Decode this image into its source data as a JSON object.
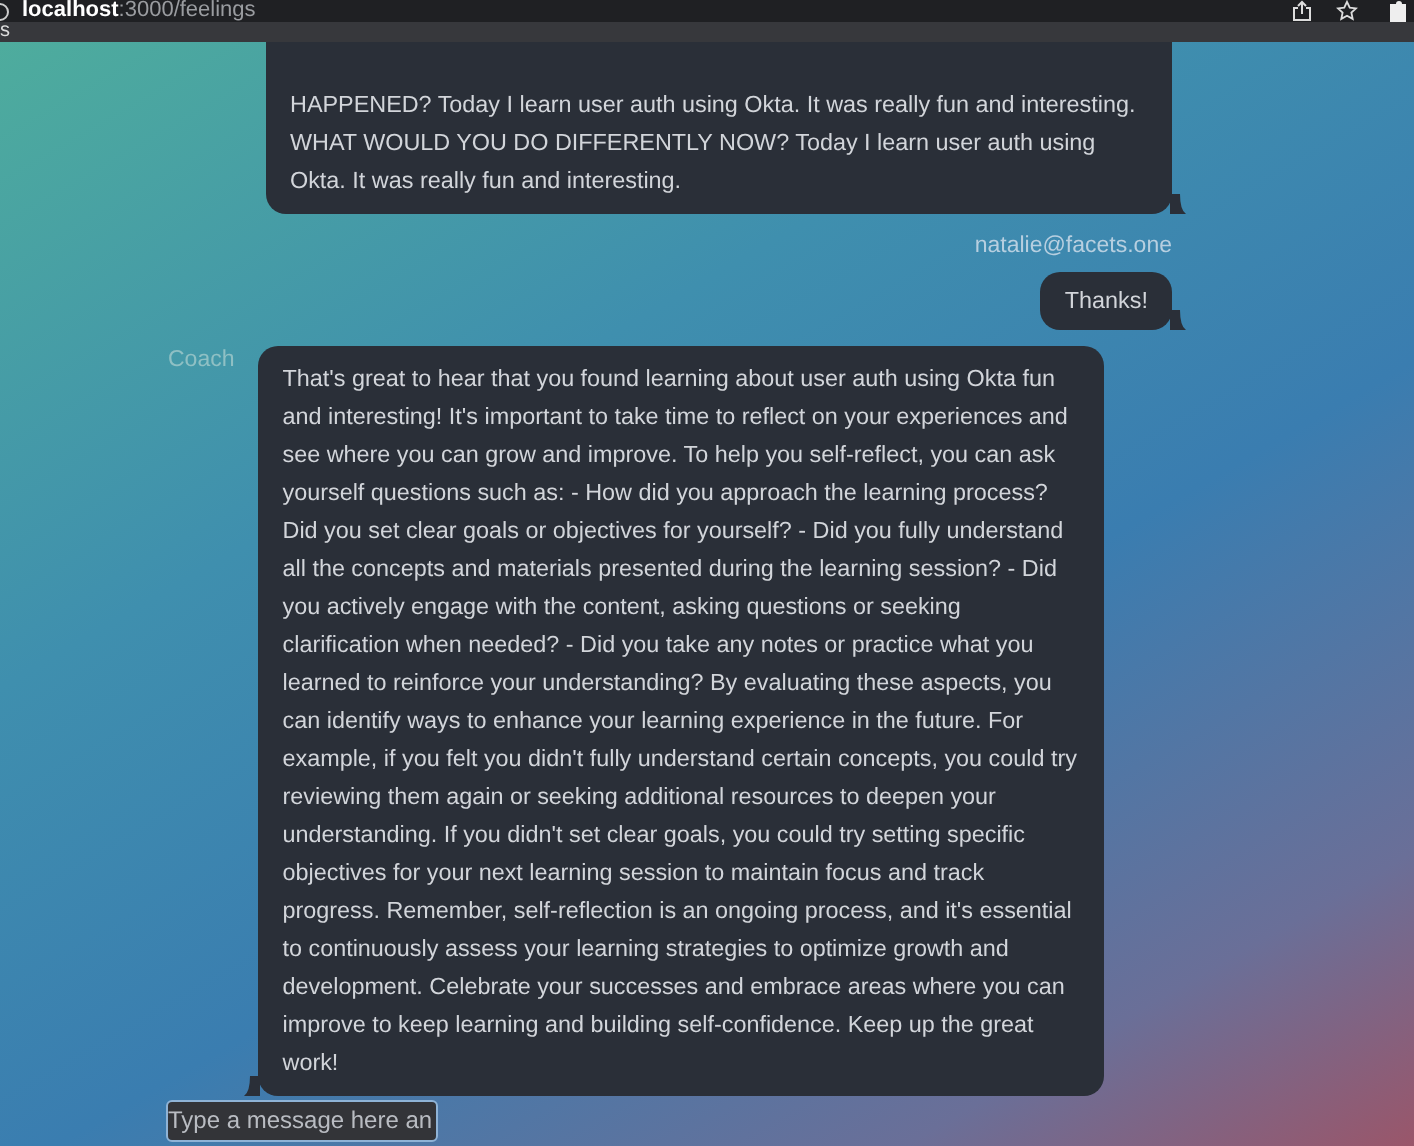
{
  "browser": {
    "url_host": "localhost",
    "url_path": ":3000/feelings",
    "bookmark": "s"
  },
  "messages": [
    {
      "kind": "user",
      "text": "HAPPENED? Today I learn user auth using Okta. It was really fun and interesting. WHAT WOULD YOU DO DIFFERENTLY NOW? Today I learn user auth using Okta. It was really fun and interesting."
    },
    {
      "kind": "user",
      "author": "natalie@facets.one",
      "text": "Thanks!"
    },
    {
      "kind": "coach",
      "author": "Coach",
      "text": "That's great to hear that you found learning about user auth using Okta fun and interesting! It's important to take time to reflect on your experiences and see where you can grow and improve. To help you self-reflect, you can ask yourself questions such as: - How did you approach the learning process? Did you set clear goals or objectives for yourself? - Did you fully understand all the concepts and materials presented during the learning session? - Did you actively engage with the content, asking questions or seeking clarification when needed? - Did you take any notes or practice what you learned to reinforce your understanding? By evaluating these aspects, you can identify ways to enhance your learning experience in the future. For example, if you felt you didn't fully understand certain concepts, you could try reviewing them again or seeking additional resources to deepen your understanding. If you didn't set clear goals, you could try setting specific objectives for your next learning session to maintain focus and track progress. Remember, self-reflection is an ongoing process, and it's essential to continuously assess your learning strategies to optimize growth and development. Celebrate your successes and embrace areas where you can improve to keep learning and building self-confidence. Keep up the great work!"
    }
  ],
  "composer": {
    "placeholder": "Type a message here an"
  }
}
